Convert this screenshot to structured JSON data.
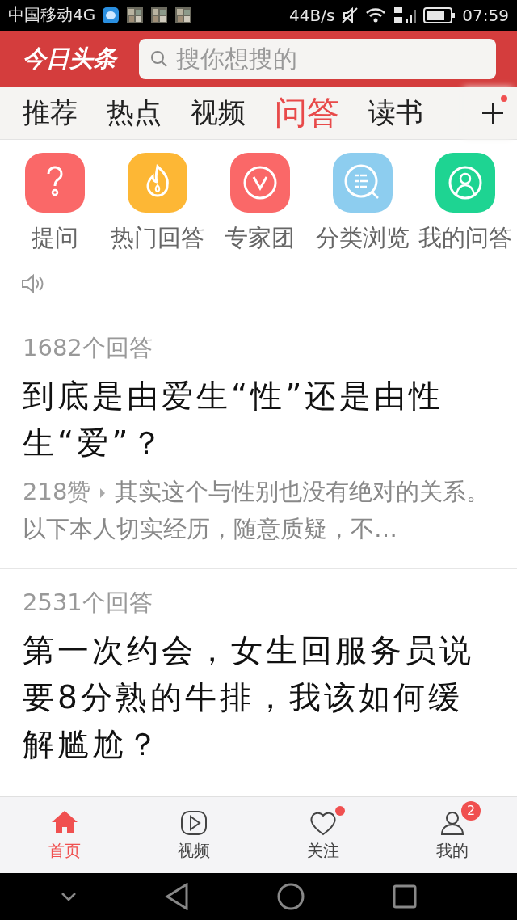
{
  "status_bar": {
    "carrier": "中国移动4G",
    "speed": "44B/s",
    "time": "07:59"
  },
  "header": {
    "logo": "今日头条",
    "search": {
      "placeholder": "搜你想搜的"
    }
  },
  "tabs": [
    {
      "label": "推荐",
      "selected": false
    },
    {
      "label": "热点",
      "selected": false
    },
    {
      "label": "视频",
      "selected": false
    },
    {
      "label": "问答",
      "selected": true
    },
    {
      "label": "读书",
      "selected": false
    }
  ],
  "add_channel": {
    "dot": true
  },
  "shortcuts": [
    {
      "label": "提问",
      "color": "#fa6868"
    },
    {
      "label": "热门回答",
      "color": "#fdb735"
    },
    {
      "label": "专家团",
      "color": "#fa6868"
    },
    {
      "label": "分类浏览",
      "color": "#8dcdef"
    },
    {
      "label": "我的问答",
      "color": "#1ed492"
    }
  ],
  "questions": [
    {
      "answers": "1682个回答",
      "title": "到底是由爱生“性”还是由性生“爱”？",
      "likes": "218赞",
      "excerpt": "其实这个与性别也没有绝对的关系。以下本人切实经历，随意质疑，不…"
    },
    {
      "answers": "2531个回答",
      "title": "第一次约会，女生回服务员说要8分熟的牛排，我该如何缓解尴尬？"
    }
  ],
  "bottom_nav": [
    {
      "label": "首页",
      "selected": true,
      "dot": false
    },
    {
      "label": "视频",
      "selected": false,
      "dot": false
    },
    {
      "label": "关注",
      "selected": false,
      "dot": true
    },
    {
      "label": "我的",
      "selected": false,
      "dot": false,
      "badge": "2"
    }
  ]
}
